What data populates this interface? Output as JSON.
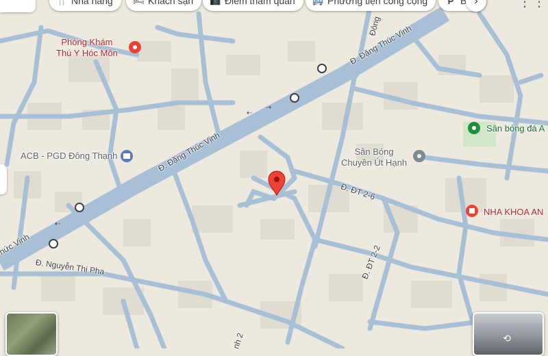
{
  "chips": [
    {
      "icon": "restaurant-icon",
      "glyph": "🍴",
      "label": "Nhà hàng"
    },
    {
      "icon": "hotel-icon",
      "glyph": "🛏",
      "label": "Khách sạn"
    },
    {
      "icon": "camera-icon",
      "glyph": "📷",
      "label": "Điểm tham quan"
    },
    {
      "icon": "transit-icon",
      "glyph": "🚌",
      "label": "Phương tiện công cộng"
    },
    {
      "icon": "parking-icon",
      "glyph": "P",
      "label": "B"
    }
  ],
  "pois": {
    "phong_kham": "Phòng Khám\nThú Y Hóc Môn",
    "acb": "ACB - PGD Đông Thạnh",
    "san_bong_da": "Sân bóng đá A",
    "san_bong_chuyen": "Sân Bóng\nChuyền Út Hạnh",
    "nha_khoa": "NHA KHOA AN"
  },
  "streets": {
    "dang_thuc_vinh_1": "Đ. Đặng Thúc Vịnh",
    "dang_thuc_vinh_2": "Đ. Đặng Thúc Vịnh",
    "thuc_vinh": "hức Vịnh",
    "nguyen_thi_pha": "Đ. Nguyễn Thị Pha",
    "dt_2_6": "Đ. ĐT 2-6",
    "dt_2_2": "Đ. ĐT 2-2",
    "dong": "Đông",
    "nh2": "nh 2"
  },
  "colors": {
    "land": "#ede9df",
    "road": "#a8c0d6",
    "main_road": "#a8c0d6",
    "building": "#e0dcd2",
    "park": "#cfe9c8",
    "pin": "#ea4335",
    "poi_red": "#c5221f",
    "poi_gray": "#5f6368"
  }
}
